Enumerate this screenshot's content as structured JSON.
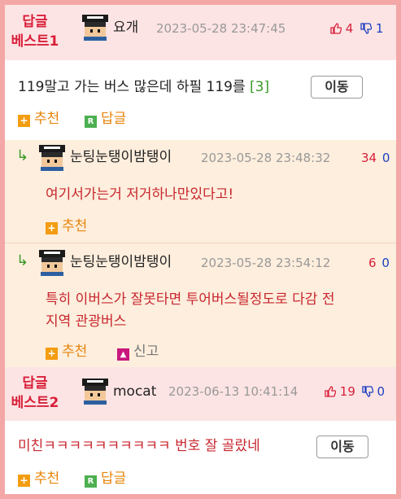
{
  "comments": [
    {
      "best_label": [
        "답글",
        "베스트1"
      ],
      "nickname": "요개",
      "time": "2023-05-28 23:47:45",
      "up": "4",
      "down": "1",
      "text": "119말고 가는 버스 많은데 하필 119를",
      "reply_count": "[3]",
      "move_label": "이동",
      "recommend_label": "추천",
      "reply_label": "답글"
    },
    {
      "best_label": [
        "답글",
        "베스트2"
      ],
      "nickname": "mocat",
      "time": "2023-06-13 10:41:14",
      "up": "19",
      "down": "0",
      "text": "미친ㅋㅋㅋㅋㅋㅋㅋㅋㅋㅋ 번호 잘 골랐네",
      "move_label": "이동",
      "recommend_label": "추천",
      "reply_label": "답글"
    }
  ],
  "replies": [
    {
      "nickname": "눈팅눈탱이밤탱이",
      "time": "2023-05-28 23:48:32",
      "up": "34",
      "down": "0",
      "text": "여기서가는거 저거하나만있다고!",
      "recommend_label": "추천"
    },
    {
      "nickname": "눈팅눈탱이밤탱이",
      "time": "2023-05-28 23:54:12",
      "up": "6",
      "down": "0",
      "text_line1": "특히 이버스가 잘못타면 투어버스될정도로 다감 전",
      "text_line2": "지역 관광버스",
      "recommend_label": "추천",
      "report_label": "신고"
    }
  ],
  "icons": {
    "reply_arrow": "reply-arrow-icon",
    "thumb_up": "thumb-up-icon",
    "thumb_down": "thumb-down-icon",
    "plus": "plus-icon",
    "reply_r": "reply-r-icon",
    "report": "report-icon"
  },
  "colors": {
    "frame": "#f4a7a7",
    "best_bg": "#fde4e4",
    "reply_bg": "#fdeedd",
    "best_label": "#d8203a",
    "up": "#d8203a",
    "down": "#1b3fbf",
    "action": "#e8840a"
  }
}
